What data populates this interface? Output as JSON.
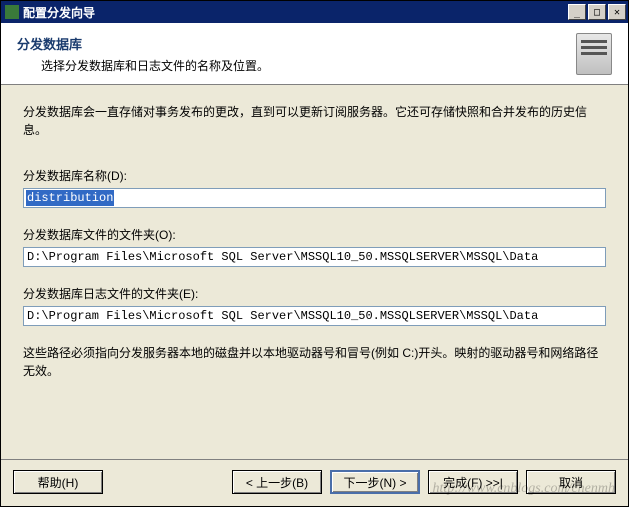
{
  "window": {
    "title": "配置分发向导"
  },
  "header": {
    "title": "分发数据库",
    "subtitle": "选择分发数据库和日志文件的名称及位置。"
  },
  "content": {
    "intro": "分发数据库会一直存储对事务发布的更改，直到可以更新订阅服务器。它还可存储快照和合并发布的历史信息。",
    "dbNameLabel": "分发数据库名称(D):",
    "dbNameValue": "distribution",
    "dataFolderLabel": "分发数据库文件的文件夹(O):",
    "dataFolderValue": "D:\\Program Files\\Microsoft SQL Server\\MSSQL10_50.MSSQLSERVER\\MSSQL\\Data",
    "logFolderLabel": "分发数据库日志文件的文件夹(E):",
    "logFolderValue": "D:\\Program Files\\Microsoft SQL Server\\MSSQL10_50.MSSQLSERVER\\MSSQL\\Data",
    "note": "这些路径必须指向分发服务器本地的磁盘并以本地驱动器号和冒号(例如 C:)开头。映射的驱动器号和网络路径无效。"
  },
  "buttons": {
    "help": "帮助(H)",
    "back": "< 上一步(B)",
    "next": "下一步(N) >",
    "finish": "完成(F) >>|",
    "cancel": "取消"
  },
  "watermark": "http://www.cnblogs.com/chenmh"
}
